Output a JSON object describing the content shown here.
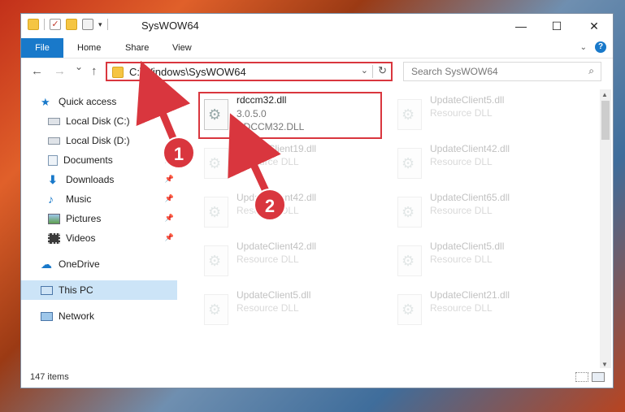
{
  "window": {
    "title": "SysWOW64",
    "controls": {
      "minimize": "—",
      "maximize": "☐",
      "close": "✕"
    }
  },
  "ribbon": {
    "tabs": [
      {
        "label": "File",
        "active": true
      },
      {
        "label": "Home"
      },
      {
        "label": "Share"
      },
      {
        "label": "View"
      }
    ]
  },
  "navigation": {
    "back": "←",
    "forward": "→",
    "recent": "⌄",
    "up": "↑",
    "address": "C:\\Windows\\SysWOW64",
    "search_placeholder": "Search SysWOW64"
  },
  "sidebar": {
    "items": [
      {
        "label": "Quick access",
        "icon": "star-icon",
        "pinned": false
      },
      {
        "label": "Local Disk (C:)",
        "icon": "drive-icon",
        "pinned": false
      },
      {
        "label": "Local Disk (D:)",
        "icon": "drive-icon",
        "pinned": false
      },
      {
        "label": "Documents",
        "icon": "documents-icon",
        "pinned": true
      },
      {
        "label": "Downloads",
        "icon": "download-icon",
        "pinned": true
      },
      {
        "label": "Music",
        "icon": "music-icon",
        "pinned": true
      },
      {
        "label": "Pictures",
        "icon": "pictures-icon",
        "pinned": true
      },
      {
        "label": "Videos",
        "icon": "videos-icon",
        "pinned": true
      },
      {
        "label": "OneDrive",
        "icon": "cloud-icon",
        "pinned": false
      },
      {
        "label": "This PC",
        "icon": "computer-icon",
        "pinned": false,
        "selected": true
      },
      {
        "label": "Network",
        "icon": "network-icon",
        "pinned": false
      }
    ]
  },
  "files": [
    {
      "name": "rdccm32.dll",
      "version": "3.0.5.0",
      "description": "RDCCM32.DLL",
      "highlighted": true
    },
    {
      "name": "UpdateClient5.dll",
      "version": "",
      "description": "Resource DLL"
    },
    {
      "name": "UpdateClient19.dll",
      "version": "",
      "description": "Resource DLL"
    },
    {
      "name": "UpdateClient42.dll",
      "version": "",
      "description": "Resource DLL"
    },
    {
      "name": "UpdateClient42.dll",
      "version": "",
      "description": "Resource DLL"
    },
    {
      "name": "UpdateClient65.dll",
      "version": "",
      "description": "Resource DLL"
    },
    {
      "name": "UpdateClient42.dll",
      "version": "",
      "description": "Resource DLL"
    },
    {
      "name": "UpdateClient5.dll",
      "version": "",
      "description": "Resource DLL"
    },
    {
      "name": "UpdateClient5.dll",
      "version": "",
      "description": "Resource DLL"
    },
    {
      "name": "UpdateClient21.dll",
      "version": "",
      "description": "Resource DLL"
    }
  ],
  "status": {
    "item_count": "147 items"
  },
  "annotations": [
    {
      "label": "1"
    },
    {
      "label": "2"
    }
  ],
  "colors": {
    "accent": "#1979ca",
    "highlight": "#d9363e",
    "selected": "#cce4f7"
  }
}
